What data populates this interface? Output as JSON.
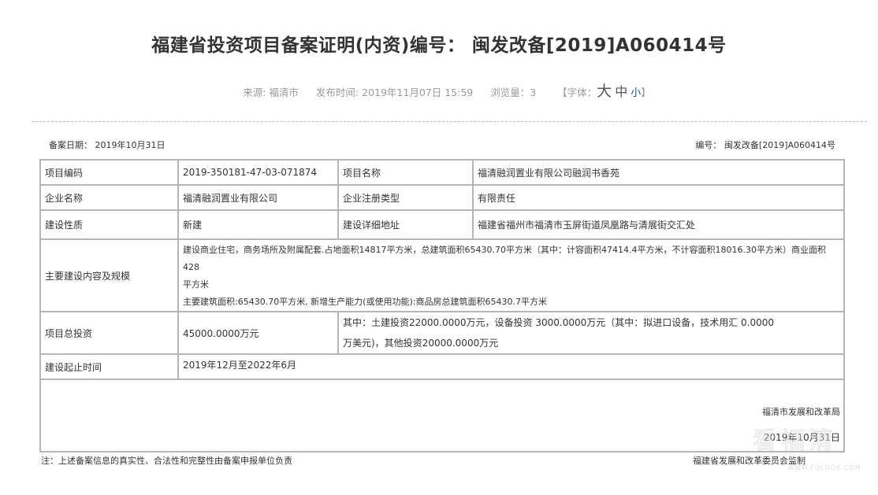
{
  "title": "福建省投资项目备案证明(内资)编号： 闽发改备[2019]A060414号",
  "meta": {
    "source": "来源: 福清市",
    "publish_time": "发布时间: 2019年11月07日 15:59",
    "views": "浏览量：3",
    "font_open": "【字体：",
    "font_big": "大",
    "font_mid": "中",
    "font_small": "小",
    "font_close": "】"
  },
  "record_date": "备案日期： 2019年10月31日",
  "record_no": "编号： 闽发改备[2019]A060414号",
  "table": {
    "project_code_label": "项目编码",
    "project_code": "2019-350181-47-03-071874",
    "project_name_label": "项目名称",
    "project_name": "福清融润置业有限公司融润书香苑",
    "company_label": "企业名称",
    "company": "福清融润置业有限公司",
    "reg_type_label": "企业注册类型",
    "reg_type": "有限责任",
    "nature_label": "建设性质",
    "nature": "新建",
    "address_label": "建设详细地址",
    "address": "福建省福州市福清市玉屏街道凤凰路与清展街交汇处",
    "content_label": "主要建设内容及规模",
    "content_line1": "建设商业住宅，商务场所及附属配套.占地面积14817平方米，总建筑面积65430.70平方米（其中：计容面积47414.4平方米，不计容面积18016.30平方米）商业面积428",
    "content_line2": "平方米",
    "content_line3": "主要建筑面积:65430.70平方米, 新增生产能力(或使用功能):商品房总建筑面积65430.7平方米",
    "investment_label": "项目总投资",
    "investment_total": "45000.0000万元",
    "investment_detail1": "其中：土建投资22000.0000万元，设备投资 3000.0000万元（其中：拟进口设备，技术用汇 0.0000",
    "investment_detail2": "万美元)，其他投资20000.0000万元",
    "period_label": "建设起止时间",
    "period": "2019年12月至2022年6月",
    "org": "福清市发展和改革局",
    "sign_date": "2019年10月31日"
  },
  "note_left": "注：上述备案信息的真实性、合法性和完整性由备案申报单位负责",
  "note_right": "福建省发展和改革委员会监制",
  "watermark": {
    "text": "看福清",
    "url": "WWW.FQLOOK.COM"
  }
}
